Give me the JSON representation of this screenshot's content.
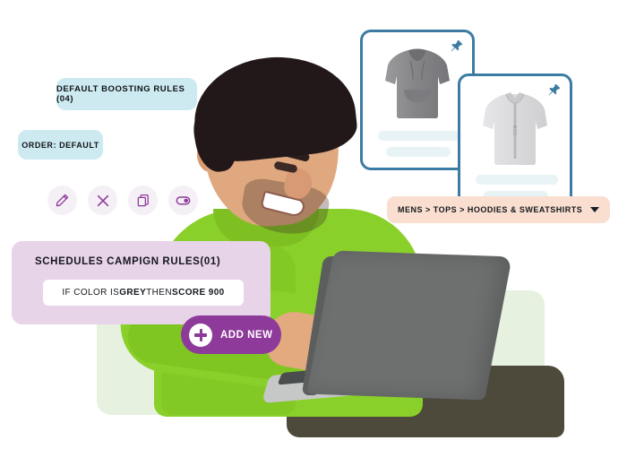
{
  "theme": {
    "chip_bg": "#cdeaf1",
    "rule_panel_bg": "#e8d4e9",
    "accent_purple": "#8e3a9a",
    "card_border": "#3c7ba3",
    "breadcrumb_bg": "#fadfd1",
    "skeleton_bg": "#e8f3f6",
    "green_plate": "#e7f1e0",
    "page_bg": "#ffffff"
  },
  "chips": {
    "boosting_rules": "DEFAULT BOOSTING RULES (04)",
    "order": "ORDER: DEFAULT"
  },
  "icon_toolbar": {
    "items": [
      {
        "name": "edit-icon",
        "label": "Edit"
      },
      {
        "name": "close-icon",
        "label": "Delete"
      },
      {
        "name": "duplicate-icon",
        "label": "Duplicate"
      },
      {
        "name": "toggle-icon",
        "label": "Enable"
      }
    ]
  },
  "rule_panel": {
    "title": "SCHEDULES CAMPIGN RULES(01)",
    "condition_prefix": "IF COLOR IS ",
    "condition_color": "GREY",
    "condition_middle": " THEN ",
    "condition_score": "SCORE 900"
  },
  "add_new_button": {
    "label": "ADD NEW",
    "icon": "plus-icon"
  },
  "product_cards": [
    {
      "pin_icon": "pushpin-icon",
      "garment": "grey-pullover-hoodie",
      "skeleton_lines": 2
    },
    {
      "pin_icon": "pushpin-icon",
      "garment": "light-grey-zip-hoodie",
      "skeleton_lines": 2
    }
  ],
  "breadcrumb": {
    "text": "MENS > TOPS > HOODIES & SWEATSHIRTS",
    "caret_icon": "chevron-down-icon"
  },
  "photo": {
    "subject": "smiling-man-with-laptop",
    "shirt_color": "#8ad02a"
  }
}
